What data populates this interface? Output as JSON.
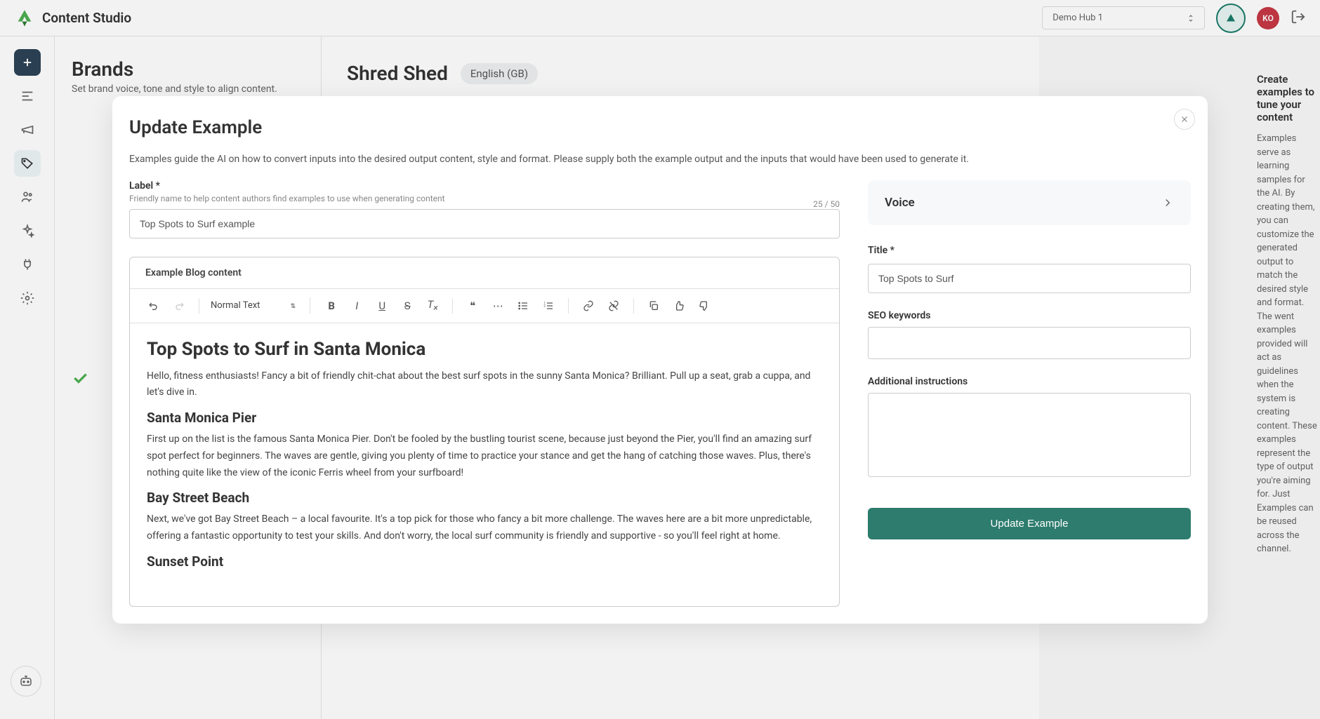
{
  "app": {
    "title": "Content Studio",
    "workspace": "Demo Hub 1",
    "user_initials": "KO"
  },
  "brands": {
    "title": "Brands",
    "subtitle": "Set brand voice, tone and style to align content."
  },
  "main": {
    "brand_name": "Shred Shed",
    "language": "English (GB)"
  },
  "sidebar": {
    "heading": "Create examples to tune your content",
    "text": "Examples serve as learning samples for the AI. By creating them, you can customize the generated output to match the desired style and format. The went examples provided will act as guidelines when the system is creating content. These examples represent the type of output you're aiming for. Just Examples can be reused across the channel."
  },
  "modal": {
    "title": "Update Example",
    "description": "Examples guide the AI on how to convert inputs into the desired output content, style and format. Please supply both the example output and the inputs that would have been used to generate it.",
    "label_label": "Label *",
    "label_hint": "Friendly name to help content authors find examples to use when generating content",
    "label_value": "Top Spots to Surf example",
    "char_count": "25 / 50",
    "editor_tab": "Example Blog content",
    "format_select": "Normal Text",
    "content": {
      "h1": "Top Spots to Surf in Santa Monica",
      "p1": "Hello, fitness enthusiasts! Fancy a bit of friendly chit-chat about the best surf spots in the sunny Santa Monica? Brilliant. Pull up a seat, grab a cuppa, and let's dive in.",
      "h2a": "Santa Monica Pier",
      "p2": "First up on the list is the famous Santa Monica Pier. Don't be fooled by the bustling tourist scene, because just beyond the Pier, you'll find an amazing surf spot perfect for beginners. The waves are gentle, giving you plenty of time to practice your stance and get the hang of catching those waves. Plus, there's nothing quite like the view of the iconic Ferris wheel from your surfboard!",
      "h2b": "Bay Street Beach",
      "p3": "Next, we've got Bay Street Beach – a local favourite. It's a top pick for those who fancy a bit more challenge. The waves here are a bit more unpredictable, offering a fantastic opportunity to test your skills. And don't worry, the local surf community is friendly and supportive - so you'll feel right at home.",
      "h2c": "Sunset Point"
    },
    "voice_label": "Voice",
    "title_label": "Title *",
    "title_value": "Top Spots to Surf",
    "seo_label": "SEO keywords",
    "additional_label": "Additional instructions",
    "update_button": "Update Example"
  }
}
